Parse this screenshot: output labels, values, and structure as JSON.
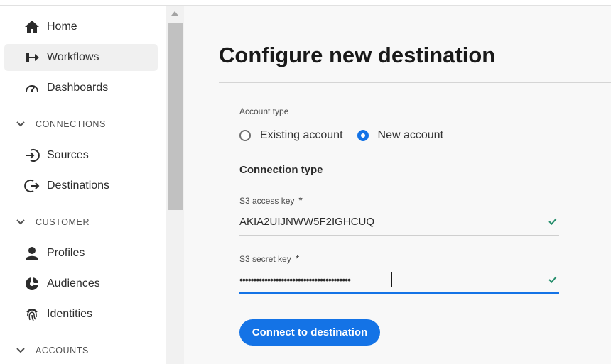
{
  "sidebar": {
    "items": [
      {
        "label": "Home",
        "icon": "home-icon"
      },
      {
        "label": "Workflows",
        "icon": "workflows-icon"
      },
      {
        "label": "Dashboards",
        "icon": "dashboard-gauge-icon"
      },
      {
        "label": "Sources",
        "icon": "sources-icon"
      },
      {
        "label": "Destinations",
        "icon": "destinations-icon"
      },
      {
        "label": "Profiles",
        "icon": "profile-icon"
      },
      {
        "label": "Audiences",
        "icon": "audiences-icon"
      },
      {
        "label": "Identities",
        "icon": "fingerprint-icon"
      }
    ],
    "sections": [
      "CONNECTIONS",
      "CUSTOMER",
      "ACCOUNTS"
    ],
    "active_item": "Workflows"
  },
  "main": {
    "title": "Configure new destination",
    "account_type_label": "Account type",
    "account_options": [
      {
        "label": "Existing account",
        "selected": false
      },
      {
        "label": "New account",
        "selected": true
      }
    ],
    "connection_type_heading": "Connection type",
    "access_key": {
      "label": "S3 access key",
      "required_mark": "*",
      "value": "AKIA2UIJNWW5F2IGHCUQ"
    },
    "secret_key": {
      "label": "S3 secret key",
      "required_mark": "*",
      "value": "••••••••••••••••••••••••••••••••••••••••"
    },
    "connect_button": "Connect to destination"
  },
  "colors": {
    "accent": "#1473e6",
    "valid": "#268e6c",
    "sidebar_active": "#f0f0f0"
  }
}
